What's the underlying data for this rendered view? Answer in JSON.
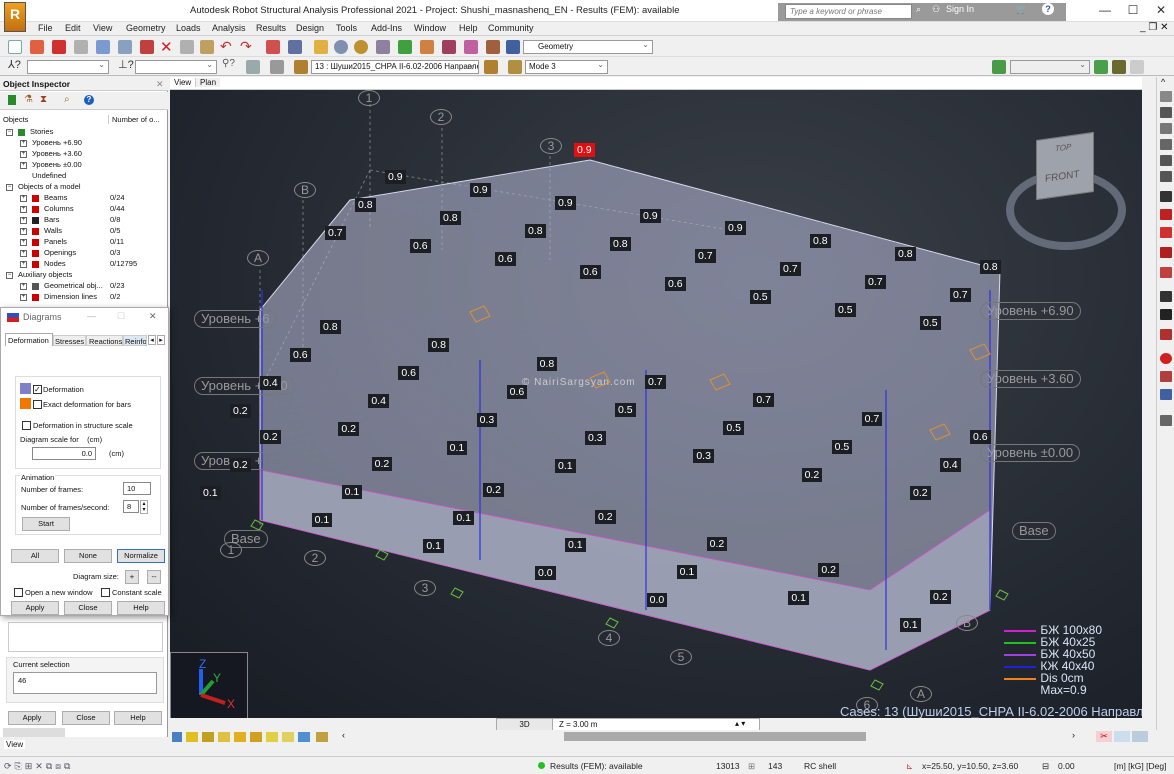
{
  "window": {
    "title": "Autodesk Robot Structural Analysis Professional 2021 - Project: Shushi_masnashenq_EN - Results (FEM): available",
    "logo": "R",
    "search_placeholder": "Type a keyword or phrase",
    "sign_in": "Sign In"
  },
  "menu": [
    "File",
    "Edit",
    "View",
    "Geometry",
    "Loads",
    "Analysis",
    "Results",
    "Design",
    "Tools",
    "Add-Ins",
    "Window",
    "Help",
    "Community"
  ],
  "toolbar": {
    "layout_combo": "Geometry",
    "case_combo": "13 : Шуши2015_СНРА II-6.02-2006 Направлен",
    "mode_combo": "Mode 3"
  },
  "inspector": {
    "title": "Object Inspector",
    "col_objects": "Objects",
    "col_number": "Number of o...",
    "tree": [
      {
        "label": "Stories",
        "count": "",
        "level": 0,
        "icon": "stories-icon",
        "color": "#2a8a2a"
      },
      {
        "label": "Уровень +6.90",
        "count": "",
        "level": 1
      },
      {
        "label": "Уровень +3.60",
        "count": "",
        "level": 1
      },
      {
        "label": "Уровень ±0.00",
        "count": "",
        "level": 1
      },
      {
        "label": "Undefined",
        "count": "",
        "level": 1,
        "leaf": true
      },
      {
        "label": "Objects of a model",
        "count": "",
        "level": 0
      },
      {
        "label": "Beams",
        "count": "0/24",
        "level": 1,
        "icon": "beam-icon",
        "color": "#c00"
      },
      {
        "label": "Columns",
        "count": "0/44",
        "level": 1,
        "icon": "column-icon",
        "color": "#c00"
      },
      {
        "label": "Bars",
        "count": "0/8",
        "level": 1,
        "icon": "bar-icon",
        "color": "#222"
      },
      {
        "label": "Walls",
        "count": "0/5",
        "level": 1,
        "icon": "wall-icon",
        "color": "#c00"
      },
      {
        "label": "Panels",
        "count": "0/11",
        "level": 1,
        "icon": "panel-icon",
        "color": "#c00"
      },
      {
        "label": "Openings",
        "count": "0/3",
        "level": 1,
        "icon": "opening-icon",
        "color": "#c00"
      },
      {
        "label": "Nodes",
        "count": "0/12795",
        "level": 1,
        "icon": "node-icon",
        "color": "#c00"
      },
      {
        "label": "Auxiliary objects",
        "count": "",
        "level": 0
      },
      {
        "label": "Geometrical obj...",
        "count": "0/23",
        "level": 1,
        "icon": "geometry-icon",
        "color": "#555"
      },
      {
        "label": "Dimension lines",
        "count": "0/2",
        "level": 1,
        "icon": "dimension-icon",
        "color": "#c00"
      }
    ],
    "current_selection_label": "Current selection",
    "current_selection_value": "46",
    "apply": "Apply",
    "close": "Close",
    "help": "Help"
  },
  "diagrams": {
    "title": "Diagrams",
    "tabs": [
      "Deformation",
      "Stresses",
      "Reactions",
      "Reinfo"
    ],
    "deformation_label": "Deformation",
    "deformation_checked": true,
    "deformation_color": "#8080c8",
    "exact_label": "Exact deformation for bars",
    "exact_checked": false,
    "exact_color": "#f07800",
    "structure_scale_label": "Deformation in structure scale",
    "scale_for_label": "Diagram scale for    (cm)",
    "scale_value": "0.0",
    "scale_unit": "(cm)",
    "animation_label": "Animation",
    "frames_label": "Number of frames:",
    "frames_value": "10",
    "fps_label": "Number of frames/second:",
    "fps_value": "8",
    "start": "Start",
    "all": "All",
    "none": "None",
    "normalize": "Normalize",
    "diagram_size_label": "Diagram size:",
    "plus": "+",
    "minus": "--",
    "open_new_window": "Open a new window",
    "constant_scale": "Constant scale",
    "apply": "Apply",
    "close": "Close",
    "help": "Help"
  },
  "view": {
    "tabs": [
      "View",
      "Plan"
    ],
    "watermark": "© NairiSargsyan.com",
    "cube_top": "TOP",
    "cube_front": "FRONT",
    "axis_labels": {
      "x": "X",
      "y": "Y",
      "z": "Z"
    },
    "grid_bubbles": [
      "1",
      "2",
      "3",
      "4",
      "5",
      "6",
      "A",
      "B",
      "A",
      "B",
      "1",
      "2",
      "3",
      "4",
      "5",
      "6"
    ],
    "levels": [
      "Уровень +6.90",
      "Уровень +3.60",
      "Уровень ±0.00",
      "Уровень +6",
      "Уровень +3.60",
      "Уровень +",
      "Base",
      "Base"
    ],
    "max_label": "0.9",
    "legend": [
      {
        "label": "БЖ 100x80",
        "color": "#d020d0"
      },
      {
        "label": "БЖ 40x25",
        "color": "#20c020"
      },
      {
        "label": "БЖ 40x50",
        "color": "#a040e0"
      },
      {
        "label": "КЖ 40x40",
        "color": "#2020e0"
      },
      {
        "label": "Dis  0cm",
        "color": "#f08020"
      }
    ],
    "legend_max": "Max=0.9",
    "cases": "Cases: 13 (Шуши2015_СНРА II-6.02-2006 Направле",
    "mode_3d": "3D",
    "z_level": "Z = 3.00 m",
    "value_labels_top": [
      "0.9",
      "0.9",
      "0.9",
      "0.9",
      "0.9",
      "0.8",
      "0.8",
      "0.8",
      "0.8",
      "0.8",
      "0.8",
      "0.8",
      "0.7",
      "0.7",
      "0.7",
      "0.7",
      "0.7",
      "0.6",
      "0.6",
      "0.6",
      "0.6",
      "0.5",
      "0.5",
      "0.5"
    ],
    "value_labels_mid": [
      "0.8",
      "0.8",
      "0.8",
      "0.7",
      "0.7",
      "0.7",
      "0.6",
      "0.6",
      "0.6",
      "0.6",
      "0.5",
      "0.5",
      "0.5",
      "0.4",
      "0.4",
      "0.4",
      "0.3",
      "0.3",
      "0.3",
      "0.2",
      "0.2",
      "0.2",
      "0.2",
      "0.1",
      "0.1"
    ],
    "value_labels_low": [
      "0.2",
      "0.2",
      "0.2",
      "0.2",
      "0.2",
      "0.2",
      "0.2",
      "0.2",
      "0.1",
      "0.1",
      "0.1",
      "0.1",
      "0.1",
      "0.1",
      "0.1",
      "0.1",
      "0.1",
      "0.0",
      "0.0"
    ]
  },
  "bottom_left_tab": "View",
  "status": {
    "results": "Results (FEM): available",
    "results_color": "#22c022",
    "nodes": "13013",
    "count": "143",
    "element": "RC shell",
    "coords": "x=25.50, y=10.50, z=3.60",
    "angle": "0.00",
    "units": "[m] [kG] [Deg]"
  }
}
